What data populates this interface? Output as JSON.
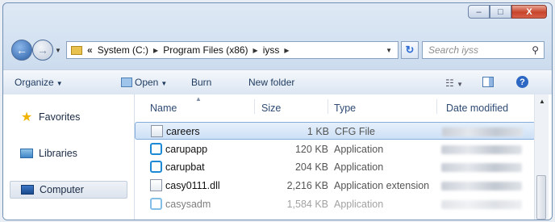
{
  "window": {
    "caption": {
      "minimize": "–",
      "maximize": "□",
      "close": "X"
    }
  },
  "address": {
    "overflow": "«",
    "crumbs": [
      "System (C:)",
      "Program Files (x86)",
      "iyss"
    ]
  },
  "search": {
    "placeholder": "Search iyss"
  },
  "toolbar": {
    "organize": "Organize",
    "open": "Open",
    "burn": "Burn",
    "new_folder": "New folder"
  },
  "nav": {
    "favorites": "Favorites",
    "libraries": "Libraries",
    "computer": "Computer"
  },
  "columns": {
    "name": "Name",
    "size": "Size",
    "type": "Type",
    "date_modified": "Date modified"
  },
  "files": [
    {
      "name": "careers",
      "size": "1 KB",
      "type": "CFG File",
      "icon": "cfg-file-icon"
    },
    {
      "name": "carupapp",
      "size": "120 KB",
      "type": "Application",
      "icon": "application-icon"
    },
    {
      "name": "carupbat",
      "size": "204 KB",
      "type": "Application",
      "icon": "application-icon"
    },
    {
      "name": "casy0111.dll",
      "size": "2,216 KB",
      "type": "Application extension",
      "icon": "dll-file-icon"
    },
    {
      "name": "casysadm",
      "size": "1,584 KB",
      "type": "Application",
      "icon": "application-icon"
    }
  ],
  "colors": {
    "selection": "#cde0f6",
    "selection_border": "#84acdd",
    "chrome": "#c6d8ec",
    "close_button": "#c7442b"
  }
}
